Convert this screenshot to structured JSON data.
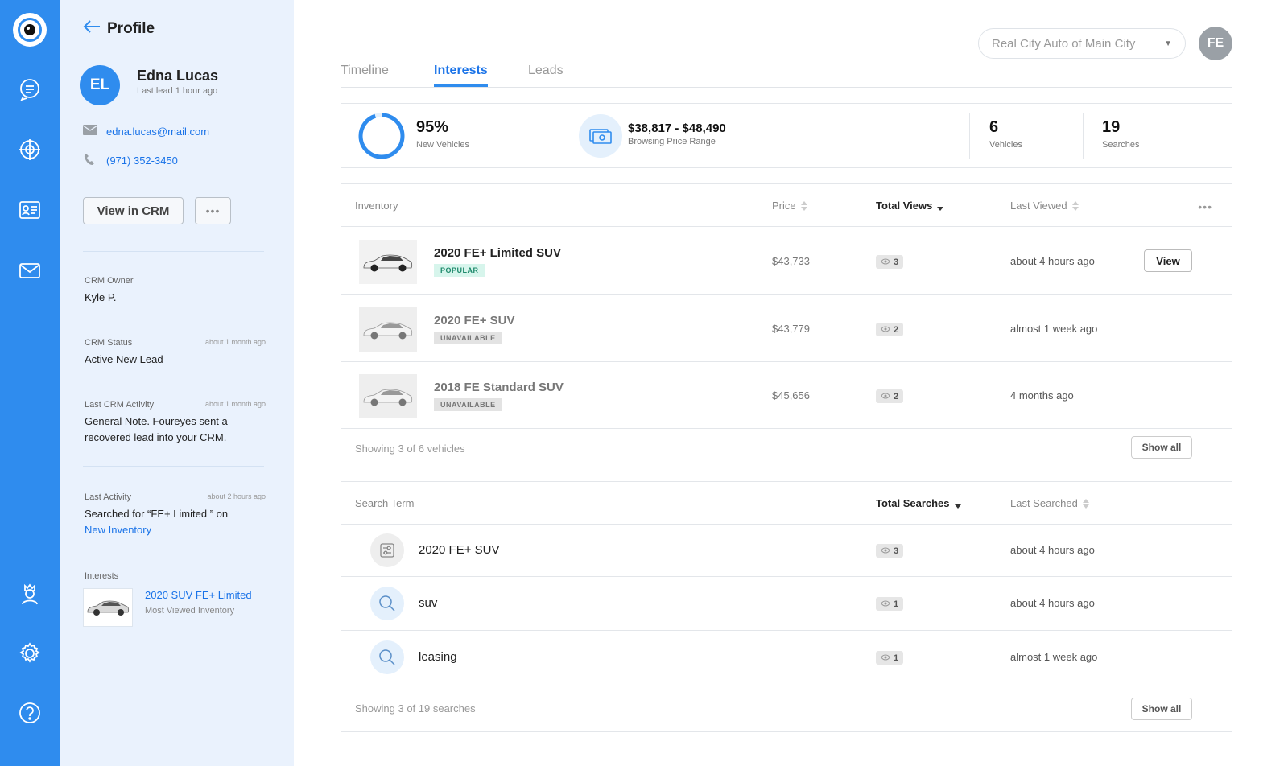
{
  "profile": {
    "back_title": "Profile",
    "initials": "EL",
    "name": "Edna Lucas",
    "last_lead": "Last lead 1 hour ago",
    "email": "edna.lucas@mail.com",
    "phone": "(971) 352-3450",
    "view_crm_label": "View in CRM",
    "crm_owner": {
      "label": "CRM Owner",
      "value": "Kyle P."
    },
    "crm_status": {
      "label": "CRM Status",
      "time": "about 1 month ago",
      "value": "Active New Lead"
    },
    "last_crm_activity": {
      "label": "Last CRM Activity",
      "time": "about 1 month ago",
      "value": "General Note. Foureyes sent a recovered lead into your CRM."
    },
    "last_activity": {
      "label": "Last Activity",
      "time": "about 2 hours ago",
      "value": "Searched for “FE+ Limited ” on",
      "link": "New Inventory"
    },
    "interests": {
      "label": "Interests",
      "name": "2020 SUV FE+ Limited",
      "sub": "Most Viewed Inventory"
    }
  },
  "header": {
    "dealer": "Real City Auto of Main City",
    "user_initials": "FE"
  },
  "tabs": [
    "Timeline",
    "Interests",
    "Leads"
  ],
  "active_tab": "Interests",
  "stats": {
    "new_pct": 95,
    "new_value": "95%",
    "new_label": "New Vehicles",
    "price_range": "$38,817 - $48,490",
    "price_label": "Browsing Price Range",
    "vehicles_value": "6",
    "vehicles_label": "Vehicles",
    "searches_value": "19",
    "searches_label": "Searches"
  },
  "inventory": {
    "columns": {
      "inventory": "Inventory",
      "price": "Price",
      "views": "Total Views",
      "last_viewed": "Last Viewed"
    },
    "rows": [
      {
        "name": "2020 FE+ Limited SUV",
        "badge": "POPULAR",
        "price": "$43,733",
        "views": "3",
        "last_viewed": "about 4 hours ago",
        "action": "View"
      },
      {
        "name": "2020 FE+ SUV",
        "badge": "UNAVAILABLE",
        "price": "$43,779",
        "views": "2",
        "last_viewed": "almost 1 week ago"
      },
      {
        "name": "2018 FE Standard SUV",
        "badge": "UNAVAILABLE",
        "price": "$45,656",
        "views": "2",
        "last_viewed": "4 months ago"
      }
    ],
    "footer": "Showing 3 of 6 vehicles",
    "show_all": "Show all"
  },
  "searches": {
    "columns": {
      "term": "Search Term",
      "total": "Total Searches",
      "last": "Last Searched"
    },
    "rows": [
      {
        "icon": "filter-icon",
        "term": "2020 FE+ SUV",
        "count": "3",
        "last": "about 4 hours ago"
      },
      {
        "icon": "search-icon",
        "term": "suv",
        "count": "1",
        "last": "about 4 hours ago"
      },
      {
        "icon": "search-icon",
        "term": "leasing",
        "count": "1",
        "last": "almost 1 week ago"
      }
    ],
    "footer": "Showing 3 of 19 searches",
    "show_all": "Show all"
  },
  "colors": {
    "primary": "#2f8cee",
    "panel": "#eaf2fd",
    "link": "#1a73e8"
  }
}
